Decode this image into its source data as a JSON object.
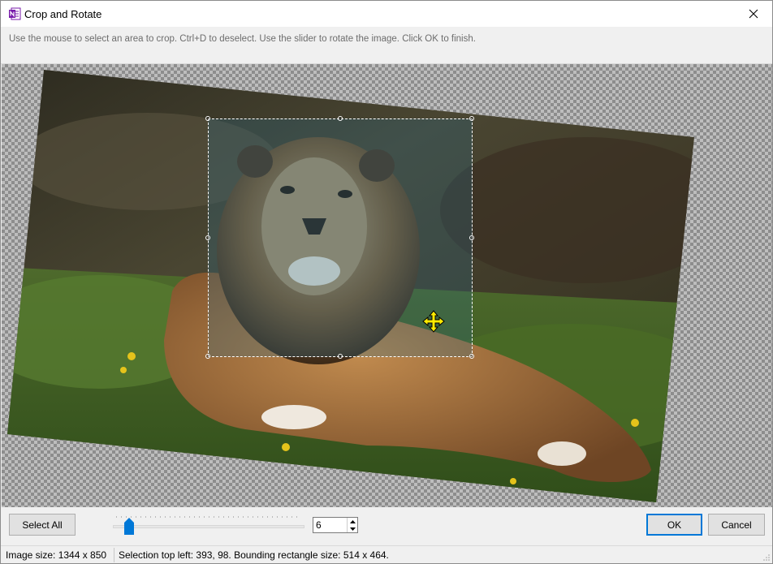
{
  "window": {
    "title": "Crop and Rotate",
    "instructions": "Use the mouse to select an area to crop. Ctrl+D to deselect. Use the slider to rotate the image. Click OK to finish."
  },
  "toolbar": {
    "select_all_label": "Select All",
    "rotation_value": "6",
    "ok_label": "OK",
    "cancel_label": "Cancel"
  },
  "slider": {
    "value": 6,
    "min": 0,
    "max": 100
  },
  "status": {
    "image_size": "Image size: 1344 x 850",
    "selection_info": "Selection top left: 393, 98. Bounding rectangle size: 514 x 464."
  },
  "icons": {
    "app": "onenote-app-icon",
    "close": "close-icon",
    "move": "move-cursor-icon"
  },
  "colors": {
    "accent": "#0078d7",
    "cursor": "#ffeb00"
  }
}
